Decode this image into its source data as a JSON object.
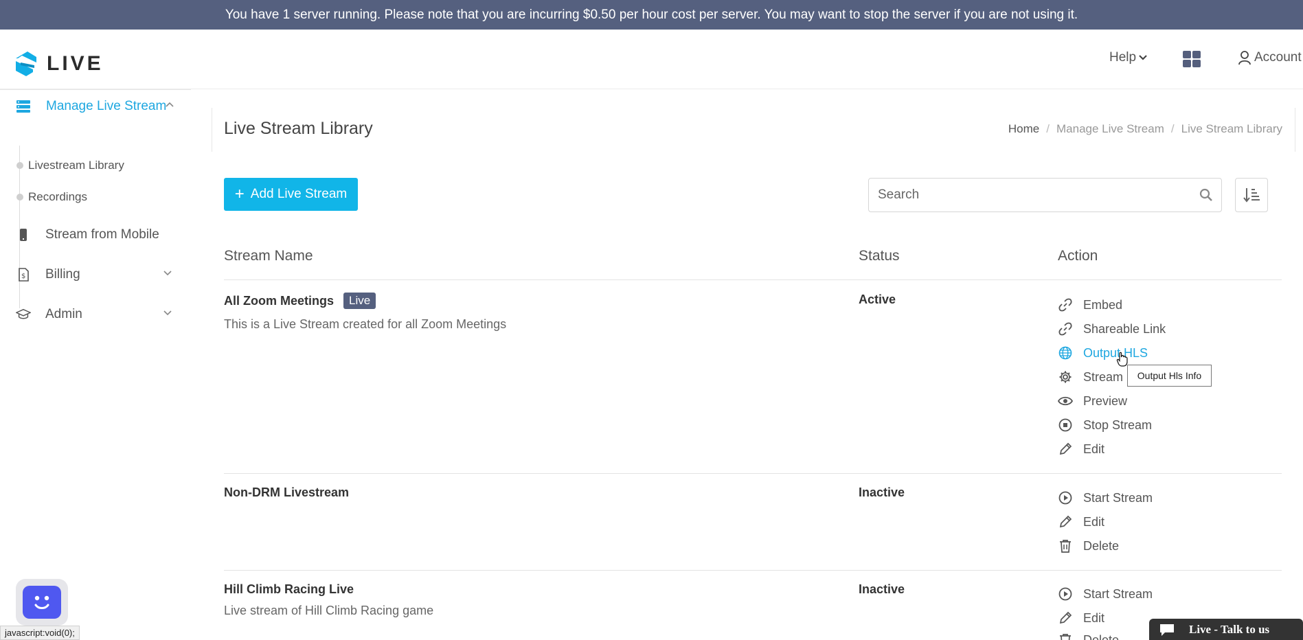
{
  "banner": {
    "text": "You have 1 server running. Please note that you are incurring $0.50 per hour cost per server. You may want to stop the server if you are not using it."
  },
  "brand": {
    "name": "LIVE"
  },
  "topnav": {
    "help": "Help",
    "account": "Account"
  },
  "sidebar": {
    "manage": {
      "label": "Manage Live Stream"
    },
    "sub_items": [
      {
        "label": "Livestream Library"
      },
      {
        "label": "Recordings"
      }
    ],
    "items": [
      {
        "label": "Stream from Mobile",
        "icon": "mobile-icon"
      },
      {
        "label": "Billing",
        "icon": "billing-icon"
      },
      {
        "label": "Admin",
        "icon": "graduation-cap-icon"
      }
    ]
  },
  "page": {
    "title": "Live Stream Library",
    "breadcrumb": [
      "Home",
      "/",
      "Manage Live Stream",
      "/",
      "Live Stream Library"
    ]
  },
  "toolbar": {
    "add_label": "Add Live Stream",
    "search_placeholder": "Search"
  },
  "table": {
    "headers": [
      "Stream Name",
      "Status",
      "Action"
    ],
    "rows": [
      {
        "name": "All Zoom Meetings",
        "badge": "Live",
        "description": "This is a Live Stream created for all Zoom Meetings",
        "status": "Active",
        "actions": [
          "Embed",
          "Shareable Link",
          "Output HLS",
          "Stream",
          "Preview",
          "Stop Stream",
          "Edit"
        ]
      },
      {
        "name": "Non-DRM Livestream",
        "status": "Inactive",
        "actions": [
          "Start Stream",
          "Edit",
          "Delete"
        ]
      },
      {
        "name": "Hill Climb Racing Live",
        "description": "Live stream of Hill Climb Racing game",
        "status": "Inactive",
        "actions": [
          "Start Stream",
          "Edit",
          "Delete"
        ]
      }
    ]
  },
  "tooltip": {
    "text": "Output Hls Info"
  },
  "status_bar": {
    "url": "javascript:void(0);"
  },
  "chat": {
    "label": "Live - Talk to us"
  },
  "colors": {
    "accent": "#11b5e8",
    "banner": "#55607f",
    "link": "#1ea7e0"
  }
}
